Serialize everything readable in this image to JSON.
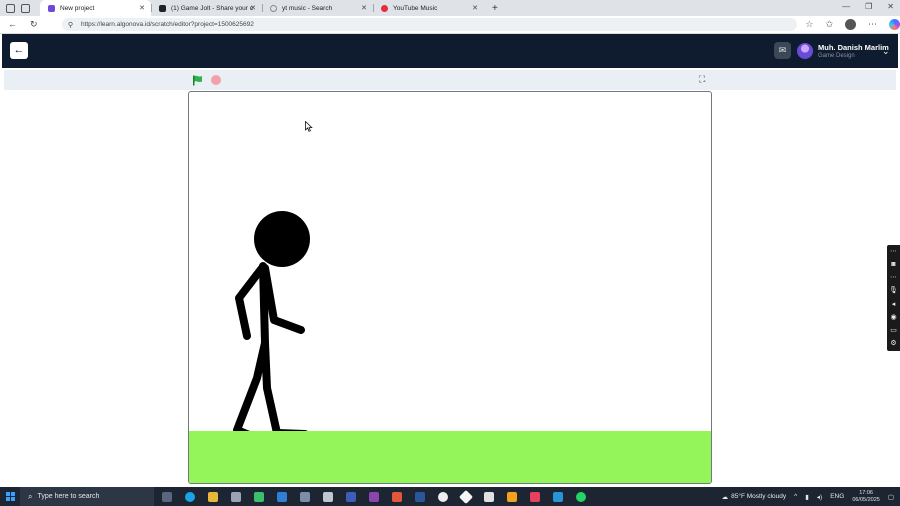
{
  "browser": {
    "tabs": [
      {
        "title": "New project",
        "favicon_color": "#6a4bd8",
        "active": true
      },
      {
        "title": "(1) Game Jolt - Share your creatio",
        "favicon_color": "#222222",
        "active": false
      },
      {
        "title": "yt music - Search",
        "favicon_color": "#888888",
        "active": false
      },
      {
        "title": "YouTube Music",
        "favicon_color": "#e52d3b",
        "active": false
      }
    ],
    "new_tab_glyph": "+",
    "url": "https://learn.algonova.id/scratch/editor?project=1500625692"
  },
  "app_header": {
    "back_icon": "arrow-left-icon",
    "user_name": "Muh. Danish Marlim",
    "user_role": "Game Design"
  },
  "stage_toolbar": {
    "flag_color": "#2fb24c",
    "stop_color": "#f2a0aa"
  },
  "stage": {
    "ground_color": "#93f55a",
    "sprite": "stick-figure"
  },
  "taskbar": {
    "search_placeholder": "Type here to search",
    "weather": "85°F  Mostly cloudy",
    "language": "ENG",
    "time": "17:06",
    "date": "06/05/2025"
  },
  "colors": {
    "header_bg": "#0f1b2e",
    "taskbar_bg": "#1d2532"
  }
}
